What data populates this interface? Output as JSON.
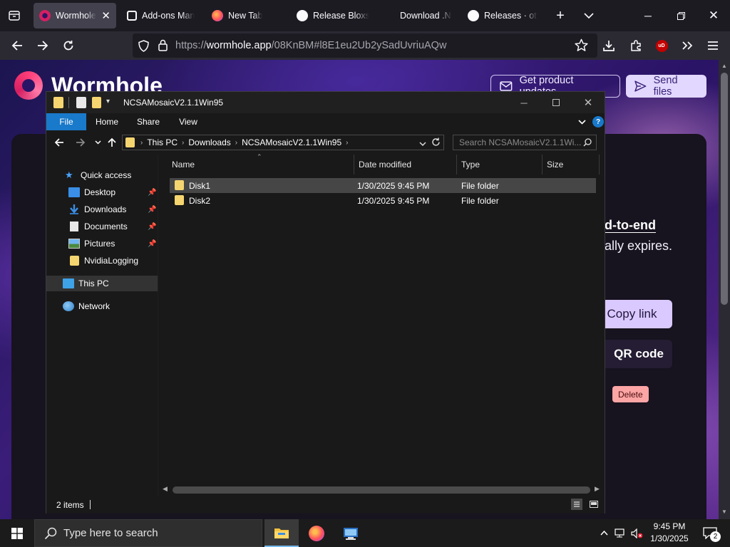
{
  "browser": {
    "tabs": [
      {
        "title": "Wormhole",
        "active": true
      },
      {
        "title": "Add-ons Man"
      },
      {
        "title": "New Tab"
      },
      {
        "title": "Release Bloxst"
      },
      {
        "title": "Download .NE"
      },
      {
        "title": "Releases · otya"
      }
    ],
    "new_tab_symbol": "+",
    "url": {
      "scheme": "https://",
      "host": "wormhole.app",
      "path": "/08KnBM#l8E1eu2Ub2ySadUvriuAQw"
    },
    "toolbar_icons": [
      "back-icon",
      "forward-icon",
      "reload-icon",
      "shield-icon",
      "lock-icon",
      "bookmark-star-icon",
      "downloads-icon",
      "extensions-icon",
      "ublock-icon",
      "overflow-icon",
      "menu-icon"
    ],
    "ublock_badge": "uD"
  },
  "webpage": {
    "brand": "Wormhole",
    "updates_button": "Get product updates",
    "send_button": "Send files",
    "e2e_fragment": "d-to-end",
    "expires_fragment": "ally expires.",
    "copy_link_button": "Copy link",
    "qr_button": "QR code",
    "delete_button": "Delete"
  },
  "explorer": {
    "title": "NCSAMosaicV2.1.1Win95",
    "ribbon_tabs": [
      "File",
      "Home",
      "Share",
      "View"
    ],
    "help_symbol": "?",
    "breadcrumb": [
      "This PC",
      "Downloads",
      "NCSAMosaicV2.1.1Win95"
    ],
    "search_placeholder": "Search NCSAMosaicV2.1.1Wi...",
    "nav_items": [
      {
        "label": "Quick access",
        "icon": "star-icon"
      },
      {
        "label": "Desktop",
        "icon": "desktop-folder-icon",
        "pinned": true
      },
      {
        "label": "Downloads",
        "icon": "download-folder-icon",
        "pinned": true
      },
      {
        "label": "Documents",
        "icon": "documents-folder-icon",
        "pinned": true
      },
      {
        "label": "Pictures",
        "icon": "pictures-folder-icon",
        "pinned": true
      },
      {
        "label": "NvidiaLogging",
        "icon": "folder-icon"
      },
      {
        "label": "This PC",
        "icon": "computer-icon",
        "selected": true
      },
      {
        "label": "Network",
        "icon": "network-icon"
      }
    ],
    "columns": [
      "Name",
      "Date modified",
      "Type",
      "Size"
    ],
    "files": [
      {
        "name": "Disk1",
        "date": "1/30/2025 9:45 PM",
        "type": "File folder",
        "size": "",
        "selected": true
      },
      {
        "name": "Disk2",
        "date": "1/30/2025 9:45 PM",
        "type": "File folder",
        "size": ""
      }
    ],
    "status": "2 items"
  },
  "taskbar": {
    "search_placeholder": "Type here to search",
    "apps": [
      "file-explorer-icon",
      "firefox-icon",
      "remote-desktop-icon"
    ],
    "time": "9:45 PM",
    "date": "1/30/2025",
    "notification_count": "2"
  },
  "colors": {
    "explorer_accent": "#1979ca",
    "wormhole_accent": "#e1d7ff",
    "delete_bg": "#fca5a5"
  }
}
